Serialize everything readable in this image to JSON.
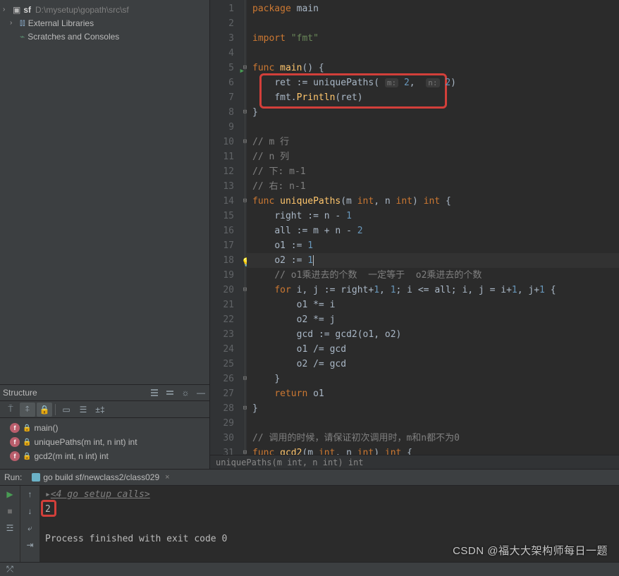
{
  "tree": {
    "root_name": "sf",
    "root_path": "D:\\mysetup\\gopath\\src\\sf",
    "item_ext_libs": "External Libraries",
    "item_scratch": "Scratches and Consoles"
  },
  "structure": {
    "title": "Structure",
    "items": [
      {
        "label": "main()"
      },
      {
        "label": "uniquePaths(m int, n int) int"
      },
      {
        "label": "gcd2(m int, n int) int"
      }
    ]
  },
  "code": {
    "lines": [
      {
        "n": 1,
        "html": "<span class='k'>package </span><span class='t'>main</span>"
      },
      {
        "n": 2,
        "html": ""
      },
      {
        "n": 3,
        "html": "<span class='k'>import </span><span class='s'>\"fmt\"</span>"
      },
      {
        "n": 4,
        "html": ""
      },
      {
        "n": 5,
        "html": "<span class='k'>func </span><span class='f'>main</span><span class='p'>() {</span>",
        "run": true,
        "fold": "-"
      },
      {
        "n": 6,
        "html": "    <span class='t'>ret</span> <span class='p'>:=</span> <span class='t'>uniquePaths</span><span class='p'>(</span> <span class='hint'>m:</span> <span class='n'>2</span><span class='p'>,</span>  <span class='hint'>n:</span> <span class='n'>2</span><span class='p'>)</span>"
      },
      {
        "n": 7,
        "html": "    <span class='t'>fmt.</span><span class='f'>Println</span><span class='p'>(</span><span class='t'>ret</span><span class='p'>)</span>"
      },
      {
        "n": 8,
        "html": "<span class='p'>}</span>",
        "fold": "-"
      },
      {
        "n": 9,
        "html": ""
      },
      {
        "n": 10,
        "html": "<span class='c'>// m 行</span>",
        "fold": "-"
      },
      {
        "n": 11,
        "html": "<span class='c'>// n 列</span>"
      },
      {
        "n": 12,
        "html": "<span class='c'>// 下: m-1</span>"
      },
      {
        "n": 13,
        "html": "<span class='c'>// 右: n-1</span>"
      },
      {
        "n": 14,
        "html": "<span class='k'>func </span><span class='f'>uniquePaths</span><span class='p'>(m </span><span class='k'>int</span><span class='p'>, n </span><span class='k'>int</span><span class='p'>) </span><span class='k'>int</span><span class='p'> {</span>",
        "fold": "-"
      },
      {
        "n": 15,
        "html": "    <span class='t'>right</span> <span class='p'>:= n -</span> <span class='n'>1</span>"
      },
      {
        "n": 16,
        "html": "    <span class='t'>all</span> <span class='p'>:= m + n -</span> <span class='n'>2</span>"
      },
      {
        "n": 17,
        "html": "    <span class='t'>o1</span> <span class='p'>:=</span> <span class='n'>1</span>"
      },
      {
        "n": 18,
        "html": "    <span class='t'>o2</span> <span class='p'>:=</span> <span class='n'>1</span><span class='caret'></span>",
        "current": true,
        "bulb": true
      },
      {
        "n": 19,
        "html": "    <span class='c'>// o1乘进去的个数  一定等于  o2乘进去的个数</span>"
      },
      {
        "n": 20,
        "html": "    <span class='k'>for </span><span class='t'>i, j</span> <span class='p'>:= right+</span><span class='n'>1</span><span class='p'>,</span> <span class='n'>1</span><span class='p'>; i &lt;= all; i, j = i+</span><span class='n'>1</span><span class='p'>, j+</span><span class='n'>1</span><span class='p'> {</span>",
        "fold": "-"
      },
      {
        "n": 21,
        "html": "        <span class='t'>o1</span> <span class='p'>*= i</span>"
      },
      {
        "n": 22,
        "html": "        <span class='t'>o2</span> <span class='p'>*= j</span>"
      },
      {
        "n": 23,
        "html": "        <span class='t'>gcd</span> <span class='p'>:=</span> <span class='t'>gcd2</span><span class='p'>(o1, o2)</span>"
      },
      {
        "n": 24,
        "html": "        <span class='t'>o1</span> <span class='p'>/= gcd</span>"
      },
      {
        "n": 25,
        "html": "        <span class='t'>o2</span> <span class='p'>/= gcd</span>"
      },
      {
        "n": 26,
        "html": "    <span class='p'>}</span>",
        "fold": "-"
      },
      {
        "n": 27,
        "html": "    <span class='k'>return </span><span class='t'>o1</span>"
      },
      {
        "n": 28,
        "html": "<span class='p'>}</span>",
        "fold": "-"
      },
      {
        "n": 29,
        "html": ""
      },
      {
        "n": 30,
        "html": "<span class='c'>// 调用的时候，请保证初次调用时，m和n都不为0</span>"
      },
      {
        "n": 31,
        "html": "<span class='k'>func </span><span class='f'>gcd2</span><span class='p'>(m </span><span class='k'>int</span><span class='p'>, n </span><span class='k'>int</span><span class='p'>) </span><span class='k'>int</span><span class='p'> {</span>",
        "fold": "-"
      }
    ],
    "breadcrumb": "uniquePaths(m int, n int) int"
  },
  "run": {
    "title": "Run:",
    "tab_label": "go build sf/newclass2/class029",
    "out_line1": "<4 go setup calls>",
    "out_line2": "2",
    "out_line3": "Process finished with exit code 0"
  },
  "watermark": "CSDN @福大大架构师每日一题"
}
